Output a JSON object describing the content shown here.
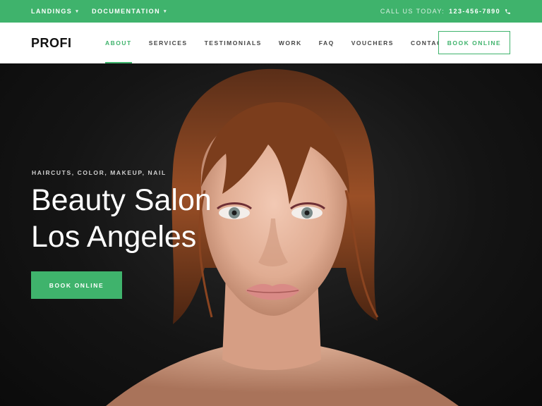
{
  "topbar": {
    "landings_label": "LANDINGS",
    "documentation_label": "DOCUMENTATION",
    "call_label": "CALL US TODAY:",
    "phone": "123-456-7890",
    "bg_color": "#3fb36c"
  },
  "header": {
    "logo": "PROFI",
    "nav": [
      {
        "label": "ABOUT",
        "active": true
      },
      {
        "label": "SERVICES",
        "active": false
      },
      {
        "label": "TESTIMONIALS",
        "active": false
      },
      {
        "label": "WORK",
        "active": false
      },
      {
        "label": "FAQ",
        "active": false
      },
      {
        "label": "VOUCHERS",
        "active": false
      },
      {
        "label": "CONTACT",
        "active": false
      }
    ],
    "book_label": "BOOK ONLINE"
  },
  "hero": {
    "eyebrow": "HAIRCUTS, COLOR, MAKEUP, NAIL",
    "title_line1": "Beauty Salon",
    "title_line2": "Los Angeles",
    "button_label": "BOOK ONLINE"
  }
}
